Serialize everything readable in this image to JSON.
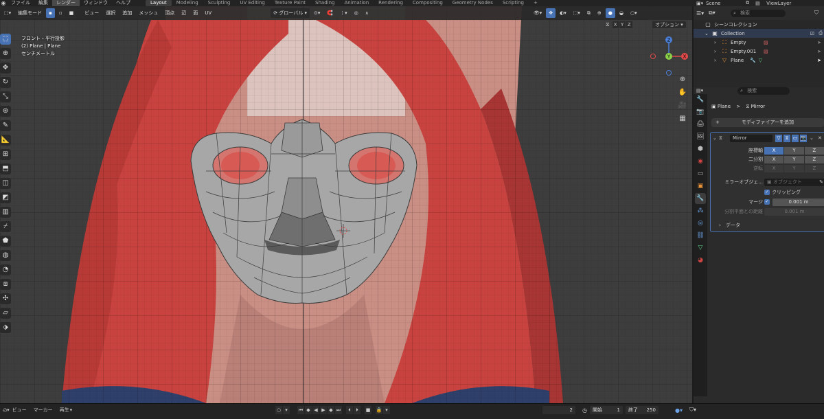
{
  "topbar": {
    "menus": [
      "ファイル",
      "編集",
      "レンダー",
      "ウィンドウ",
      "ヘルプ"
    ],
    "active_menu_index": 2,
    "workspaces": [
      "Layout",
      "Modeling",
      "Sculpting",
      "UV Editing",
      "Texture Paint",
      "Shading",
      "Animation",
      "Rendering",
      "Compositing",
      "Geometry Nodes",
      "Scripting"
    ],
    "active_workspace": "Layout",
    "add_workspace": "+",
    "scene_label": "Scene",
    "view_layer_label": "ViewLayer"
  },
  "viewport_header": {
    "mode": "編集モード",
    "menus": [
      "ビュー",
      "選択",
      "追加",
      "メッシュ",
      "頂点",
      "辺",
      "面",
      "UV"
    ],
    "transform_orientation": "グローバル",
    "options_label": "オプション",
    "axis_buttons": [
      "X",
      "Y",
      "Z"
    ]
  },
  "viewport_info": {
    "view_name": "フロント・平行投影",
    "object_line": "(2) Plane | Plane",
    "units_line": "センチメートル"
  },
  "gizmo": {
    "z": "Z",
    "y": "Y",
    "x": "X"
  },
  "timeline": {
    "menus": [
      "ビュー",
      "マーカー",
      "再生"
    ],
    "current_frame": "2",
    "start_label": "開始",
    "start_value": "1",
    "end_label": "終了",
    "end_value": "250"
  },
  "outliner": {
    "search_placeholder": "検索",
    "scene_collection": "シーンコレクション",
    "collection": "Collection",
    "items": [
      "Empty",
      "Empty.001",
      "Plane"
    ]
  },
  "properties": {
    "search_placeholder": "検索",
    "breadcrumb_object": "Plane",
    "breadcrumb_sep": ">",
    "breadcrumb_modifier": "Mirror",
    "add_modifier": "モディファイアーを追加",
    "modifier_name": "Mirror",
    "axis_label": "座標軸",
    "bisect_label": "二分割",
    "flip_label": "逆転",
    "xyz": [
      "X",
      "Y",
      "Z"
    ],
    "mirror_object_label": "ミラーオブジェ...",
    "mirror_object_placeholder": "オブジェクト",
    "clipping_label": "クリッピング",
    "merge_label": "マージ",
    "merge_value": "0.001 m",
    "bisect_distance_label": "分割平面との距離",
    "bisect_distance_value": "0.001 m",
    "data_section": "データ"
  },
  "colors": {
    "accent_blue": "#4772b3",
    "hair_red": "#c9433f",
    "mesh_gray": "#a9a9a9"
  }
}
